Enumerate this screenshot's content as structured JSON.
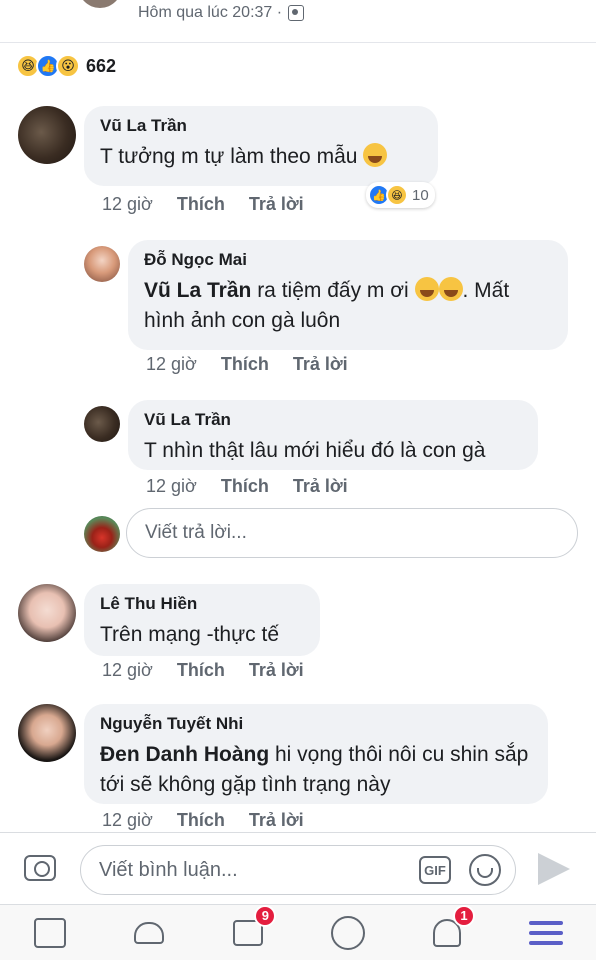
{
  "post": {
    "timestamp": "Hôm qua lúc 20:37 ·"
  },
  "reactions": {
    "count": "662",
    "types": [
      "haha",
      "like",
      "wow"
    ]
  },
  "comments": [
    {
      "author": "Vũ La Trần",
      "text": "T tưởng m tự làm theo mẫu",
      "time": "12 giờ",
      "like": "Thích",
      "reply": "Trả lời",
      "reaction_count": "10",
      "replies": [
        {
          "author": "Đỗ Ngọc Mai",
          "mention": "Vũ La Trần",
          "text": " ra tiệm đấy m ơi",
          "text2": ". Mất hình ảnh con gà luôn",
          "time": "12 giờ",
          "like": "Thích",
          "reply": "Trả lời"
        },
        {
          "author": "Vũ La Trần",
          "text": "T nhìn thật lâu mới hiểu đó là con gà",
          "time": "12 giờ",
          "like": "Thích",
          "reply": "Trả lời"
        }
      ],
      "reply_placeholder": "Viết trả lời..."
    },
    {
      "author": "Lê Thu Hiền",
      "text": "Trên mạng -thực tế",
      "time": "12 giờ",
      "like": "Thích",
      "reply": "Trả lời"
    },
    {
      "author": "Nguyễn Tuyết Nhi",
      "mention": "Đen Danh Hoàng",
      "text": " hi vọng thôi nôi cu shin sắp tới sẽ không gặp tình trạng này",
      "time": "12 giờ",
      "like": "Thích",
      "reply": "Trả lời"
    }
  ],
  "composer": {
    "placeholder": "Viết bình luận...",
    "gif_label": "GIF"
  },
  "tabbar": {
    "items": [
      {
        "icon": "news-feed-icon"
      },
      {
        "icon": "friends-icon"
      },
      {
        "icon": "watch-icon",
        "badge": "9"
      },
      {
        "icon": "profile-icon"
      },
      {
        "icon": "notifications-icon",
        "badge": "1"
      },
      {
        "icon": "menu-icon"
      }
    ]
  },
  "colors": {
    "accent": "#2078f4",
    "badge": "#e41e3f",
    "menu": "#5b5fc7"
  }
}
